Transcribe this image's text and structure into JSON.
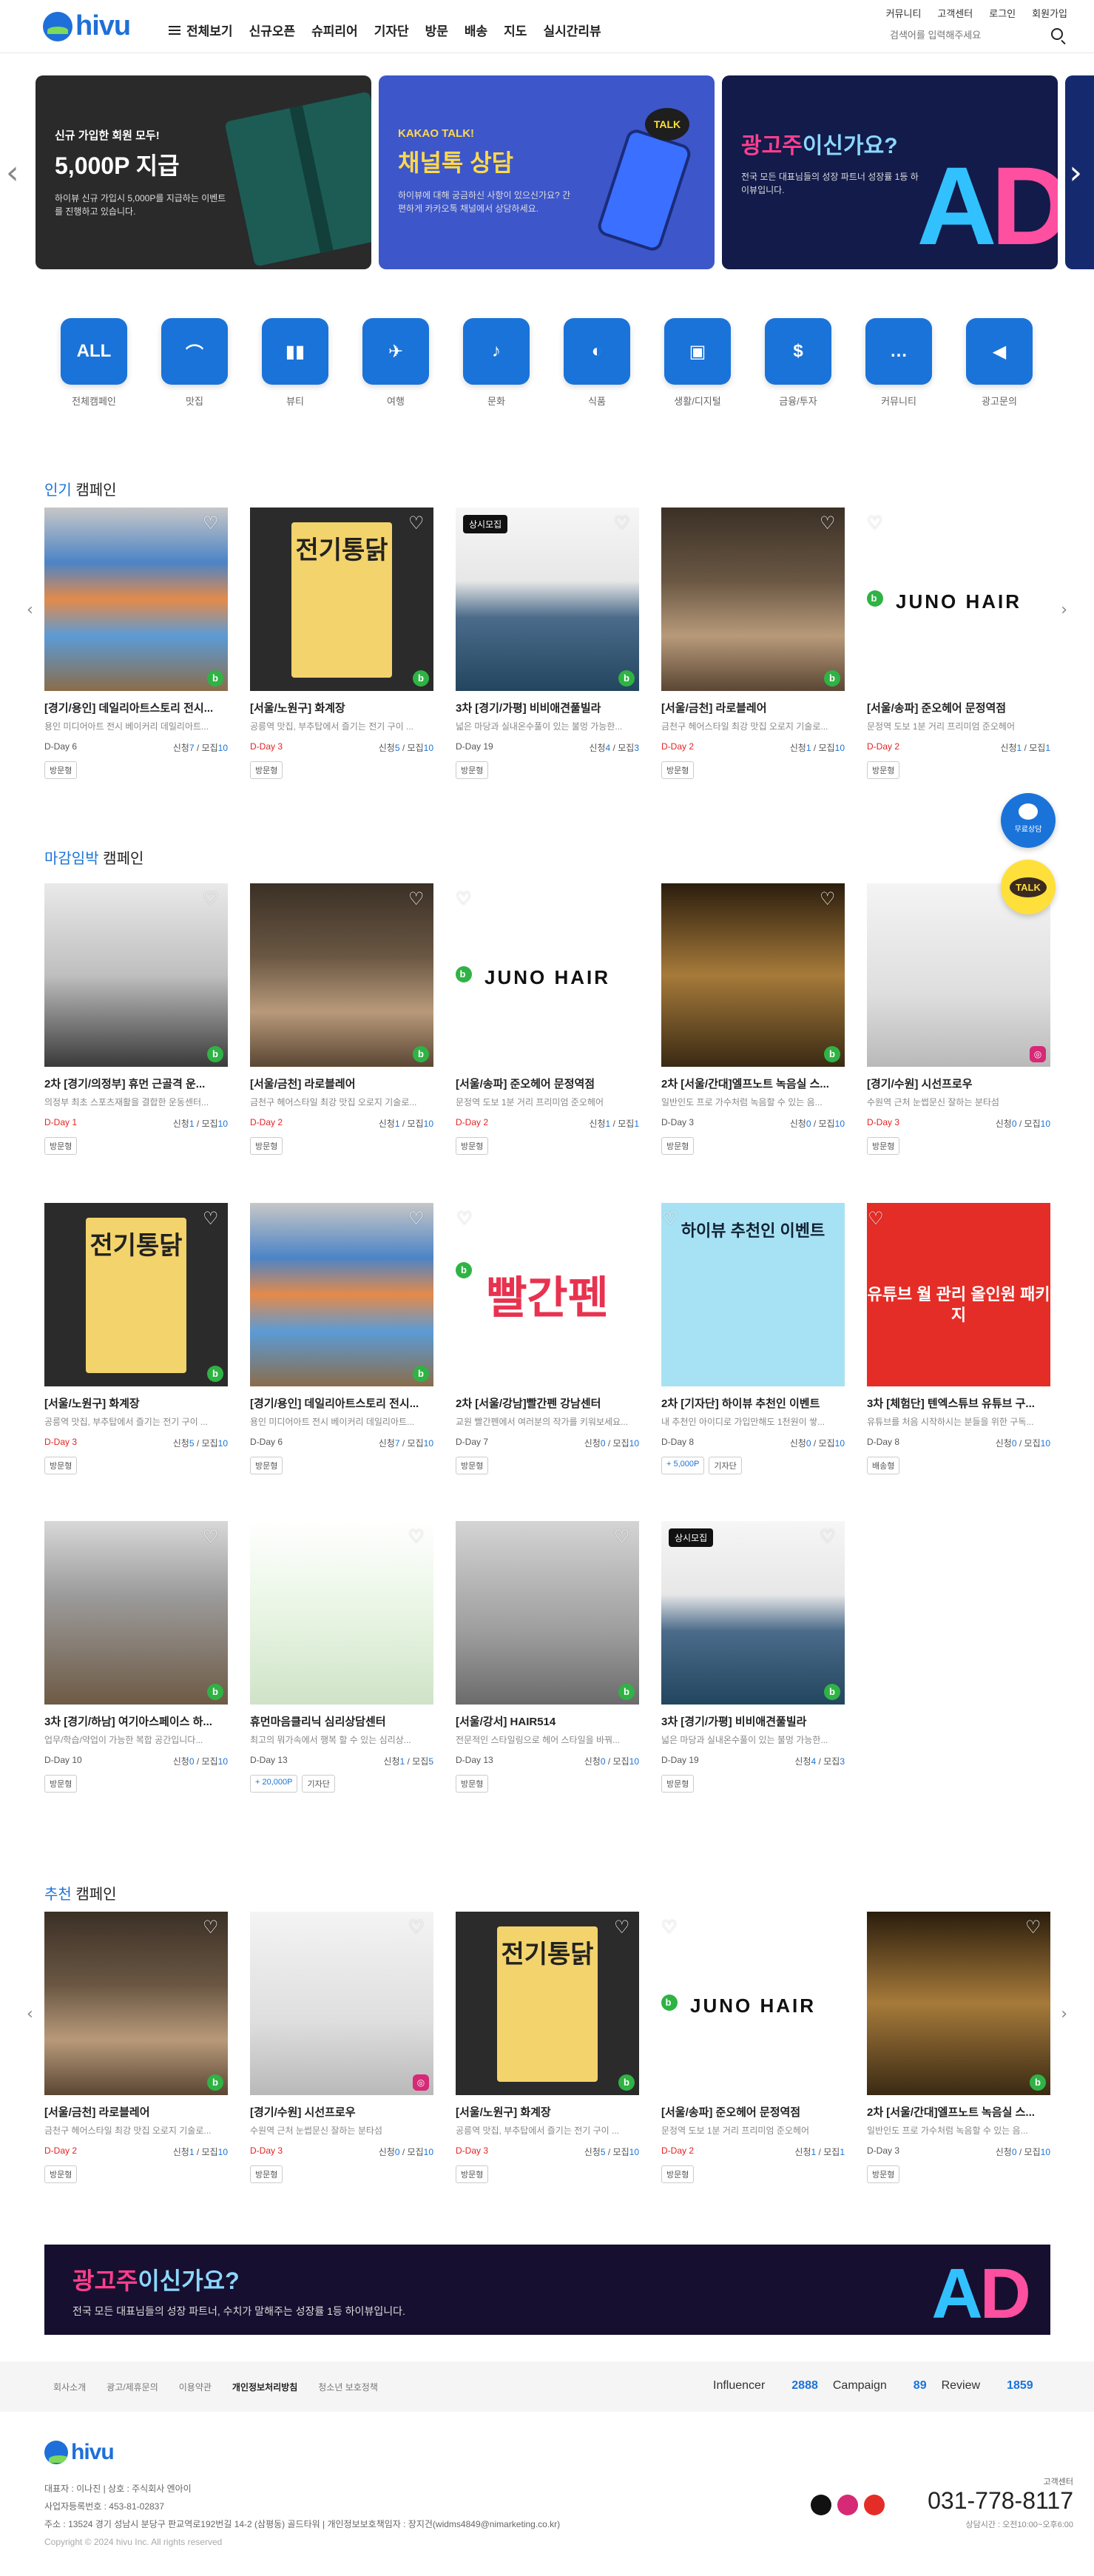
{
  "header": {
    "logo": "hivu",
    "nav": [
      "전체보기",
      "신규오픈",
      "슈피리어",
      "기자단",
      "방문",
      "배송",
      "지도",
      "실시간리뷰"
    ],
    "util": [
      "커뮤니티",
      "고객센터",
      "로그인",
      "회원가입"
    ],
    "search_placeholder": "검색어를 입력해주세요"
  },
  "banners": [
    {
      "small": "신규 가입한 회원 모두!",
      "big": "5,000P 지급",
      "desc": "하이뷰 신규 가입시 5,000P를 지급하는 이벤트를 진행하고 있습니다."
    },
    {
      "small": "KAKAO TALK!",
      "big": "채널톡 상담",
      "desc": "하이뷰에 대해 궁금하신 사항이 있으신가요? 간편하게 카카오톡 채널에서 상담하세요.",
      "talk": "TALK"
    },
    {
      "big_a": "광고주",
      "big_b": "이신가요?",
      "desc": "전국 모든 대표님들의 성장 파트너 성장률 1등 하이뷰입니다.",
      "ad_a": "A",
      "ad_b": "D"
    }
  ],
  "categories": [
    {
      "label": "전체캠페인",
      "icon_text": "ALL",
      "icon": "all-icon"
    },
    {
      "label": "맛집",
      "icon": "food-icon"
    },
    {
      "label": "뷰티",
      "icon": "beauty-icon"
    },
    {
      "label": "여행",
      "icon": "airplane-icon"
    },
    {
      "label": "문화",
      "icon": "culture-icon"
    },
    {
      "label": "식품",
      "icon": "food-product-icon"
    },
    {
      "label": "생활/디지털",
      "icon": "camera-icon"
    },
    {
      "label": "금융/투자",
      "icon": "coin-icon"
    },
    {
      "label": "커뮤니티",
      "icon": "chat-icon"
    },
    {
      "label": "광고문의",
      "icon": "megaphone-icon"
    }
  ],
  "sections": {
    "popular": {
      "accent": "인기",
      "rest": " 캠페인"
    },
    "closing": {
      "accent": "마감임박",
      "rest": " 캠페인"
    },
    "recommend": {
      "accent": "추천",
      "rest": " 캠페인"
    }
  },
  "labels": {
    "applied": "신청",
    "recruit": "모집",
    "visit": "방문형",
    "delivery": "배송형",
    "reporter": "기자단",
    "recruiting": "상시모집"
  },
  "popular": [
    {
      "art": "t-art",
      "title": "[경기/용인] 데일리아트스토리 전시...",
      "desc": "용인 미디어아트 전시 베이커리 데일리아트...",
      "dday": "D-Day 6",
      "red": false,
      "applied": "7",
      "recruit": "10",
      "badges": [
        "방문형"
      ],
      "icon": "blog"
    },
    {
      "art": "t-chicken",
      "title": "[서울/노원구] 화계장",
      "desc": "공릉역 맛집, 부추탑에서 즐기는 전기 구이 ...",
      "dday": "D-Day 3",
      "red": true,
      "applied": "5",
      "recruit": "10",
      "badges": [
        "방문형"
      ],
      "icon": "blog"
    },
    {
      "art": "t-pool",
      "title": "3차 [경기/가평] 비비애견풀빌라",
      "desc": "넓은 마당과 실내온수풀이 있는 불멍 가능한...",
      "dday": "D-Day 19",
      "red": false,
      "applied": "4",
      "recruit": "3",
      "badges": [
        "방문형"
      ],
      "icon": "blog",
      "tag": "상시모집"
    },
    {
      "art": "t-salon",
      "title": "[서울/금천] 라로블레어",
      "desc": "금천구 헤어스타일 최강 맛집 오로지 기술로...",
      "dday": "D-Day 2",
      "red": true,
      "applied": "1",
      "recruit": "10",
      "badges": [
        "방문형"
      ],
      "icon": "blog"
    },
    {
      "art": "t-juno",
      "title": "[서울/송파] 준오헤어 문정역점",
      "desc": "문정역 도보 1분 거리 프리미엄 준오헤어",
      "dday": "D-Day 2",
      "red": true,
      "applied": "1",
      "recruit": "1",
      "badges": [
        "방문형"
      ],
      "icon": "blog",
      "juno": "JUNO HAIR"
    }
  ],
  "closing": [
    {
      "art": "t-gym",
      "title": "2차 [경기/의정부] 휴먼 근골격 운...",
      "desc": "의정부 최초 스포츠재활을 결합한 운동센터...",
      "dday": "D-Day 1",
      "red": true,
      "applied": "1",
      "recruit": "10",
      "badges": [
        "방문형"
      ],
      "icon": "blog"
    },
    {
      "art": "t-salon",
      "title": "[서울/금천] 라로블레어",
      "desc": "금천구 헤어스타일 최강 맛집 오로지 기술로...",
      "dday": "D-Day 2",
      "red": true,
      "applied": "1",
      "recruit": "10",
      "badges": [
        "방문형"
      ],
      "icon": "blog"
    },
    {
      "art": "t-juno",
      "title": "[서울/송파] 준오헤어 문정역점",
      "desc": "문정역 도보 1분 거리 프리미엄 준오헤어",
      "dday": "D-Day 2",
      "red": true,
      "applied": "1",
      "recruit": "1",
      "badges": [
        "방문형"
      ],
      "icon": "blog",
      "juno": "JUNO HAIR"
    },
    {
      "art": "t-mic",
      "title": "2차 [서울/간대]엘프노트 녹음실 스...",
      "desc": "일반인도 프로 가수처럼 녹음할 수 있는 음...",
      "dday": "D-Day 3",
      "red": false,
      "applied": "0",
      "recruit": "10",
      "badges": [
        "방문형"
      ],
      "icon": "blog"
    },
    {
      "art": "t-white",
      "title": "[경기/수원] 시선프로우",
      "desc": "수원역 근처 눈썹문신 잘하는 분타섬",
      "dday": "D-Day 3",
      "red": true,
      "applied": "0",
      "recruit": "10",
      "badges": [
        "방문형"
      ],
      "icon": "insta"
    },
    {
      "art": "t-chicken",
      "title": "[서울/노원구] 화계장",
      "desc": "공릉역 맛집, 부추탑에서 즐기는 전기 구이 ...",
      "dday": "D-Day 3",
      "red": true,
      "applied": "5",
      "recruit": "10",
      "badges": [
        "방문형"
      ],
      "icon": "blog"
    },
    {
      "art": "t-art",
      "title": "[경기/용인] 데일리아트스토리 전시...",
      "desc": "용인 미디어아트 전시 베이커리 데일리아트...",
      "dday": "D-Day 6",
      "red": false,
      "applied": "7",
      "recruit": "10",
      "badges": [
        "방문형"
      ],
      "icon": "blog"
    },
    {
      "art": "t-ppalgan",
      "title": "2차 [서울/강남]빨간펜 강남센터",
      "desc": "교원 빨간펜에서 여러분의 작가를 키워보세요...",
      "dday": "D-Day 7",
      "red": false,
      "applied": "0",
      "recruit": "10",
      "badges": [
        "방문형"
      ],
      "icon": "blog",
      "big": "빨간펜"
    },
    {
      "art": "t-event",
      "title": "2차 [기자단] 하이뷰 추천인 이벤트",
      "desc": "내 추천인 아이디로 가입만해도 1천원이 쌓...",
      "dday": "D-Day 8",
      "red": false,
      "applied": "0",
      "recruit": "10",
      "badges": [
        "+ 5,000P",
        "기자단"
      ],
      "icon": "none",
      "event": "하이뷰 추천인 이벤트"
    },
    {
      "art": "t-youtube",
      "title": "3차 [체험단] 텐엑스튜브 유튜브 구...",
      "desc": "유튜브를 처음 시작하시는 분들을 위한 구독...",
      "dday": "D-Day 8",
      "red": false,
      "applied": "0",
      "recruit": "10",
      "badges": [
        "배송형"
      ],
      "icon": "none",
      "yt": "유튜브 월 관리 올인원 패키지"
    },
    {
      "art": "t-cafe",
      "title": "3차 [경기/하남] 여기아스페이스 하...",
      "desc": "업무/학습/약업이 가능한 복합 공간입니다...",
      "dday": "D-Day 10",
      "red": false,
      "applied": "0",
      "recruit": "10",
      "badges": [
        "방문형"
      ],
      "icon": "blog"
    },
    {
      "art": "t-clinic",
      "title": "휴먼마음클리닉 심리상담센터",
      "desc": "최고의 뭐가속에서 행복 할 수 있는 심리상...",
      "dday": "D-Day 13",
      "red": false,
      "applied": "1",
      "recruit": "5",
      "badges": [
        "+ 20,000P",
        "기자단"
      ],
      "icon": "none"
    },
    {
      "art": "t-hair514",
      "title": "[서울/강서] HAIR514",
      "desc": "전문적인 스타일링으로 헤어 스타일을 바꿔...",
      "dday": "D-Day 13",
      "red": false,
      "applied": "0",
      "recruit": "10",
      "badges": [
        "방문형"
      ],
      "icon": "blog"
    },
    {
      "art": "t-pool",
      "title": "3차 [경기/가평] 비비애견풀빌라",
      "desc": "넓은 마당과 실내온수풀이 있는 불멍 가능한...",
      "dday": "D-Day 19",
      "red": false,
      "applied": "4",
      "recruit": "3",
      "badges": [
        "방문형"
      ],
      "icon": "blog",
      "tag": "상시모집"
    }
  ],
  "recommend": [
    {
      "art": "t-salon",
      "title": "[서울/금천] 라로블레어",
      "desc": "금천구 헤어스타일 최강 맛집 오로지 기술로...",
      "dday": "D-Day 2",
      "red": true,
      "applied": "1",
      "recruit": "10",
      "badges": [
        "방문형"
      ],
      "icon": "blog"
    },
    {
      "art": "t-white",
      "title": "[경기/수원] 시선프로우",
      "desc": "수원역 근처 눈썹문신 잘하는 분타섬",
      "dday": "D-Day 3",
      "red": true,
      "applied": "0",
      "recruit": "10",
      "badges": [
        "방문형"
      ],
      "icon": "insta"
    },
    {
      "art": "t-chicken",
      "title": "[서울/노원구] 화계장",
      "desc": "공릉역 맛집, 부추탑에서 즐기는 전기 구이 ...",
      "dday": "D-Day 3",
      "red": true,
      "applied": "5",
      "recruit": "10",
      "badges": [
        "방문형"
      ],
      "icon": "blog"
    },
    {
      "art": "t-juno",
      "title": "[서울/송파] 준오헤어 문정역점",
      "desc": "문정역 도보 1분 거리 프리미엄 준오헤어",
      "dday": "D-Day 2",
      "red": true,
      "applied": "1",
      "recruit": "1",
      "badges": [
        "방문형"
      ],
      "icon": "blog",
      "juno": "JUNO HAIR"
    },
    {
      "art": "t-mic",
      "title": "2차 [서울/간대]엘프노트 녹음실 스...",
      "desc": "일반인도 프로 가수처럼 녹음할 수 있는 음...",
      "dday": "D-Day 3",
      "red": false,
      "applied": "0",
      "recruit": "10",
      "badges": [
        "방문형"
      ],
      "icon": "blog"
    }
  ],
  "float": {
    "consult": "무료상담",
    "talk": "TALK"
  },
  "adstrip": {
    "big_a": "광고주",
    "big_b": "이신가요?",
    "small": "전국 모든 대표님들의 성장 파트너, 수치가 말해주는 성장률 1등 하이뷰입니다.",
    "ad_a": "A",
    "ad_b": "D"
  },
  "footer": {
    "links": [
      "회사소개",
      "광고/제휴문의",
      "이용약관",
      "개인정보처리방침",
      "청소년 보호정책"
    ],
    "stats": [
      {
        "label": "Influencer",
        "value": "2888"
      },
      {
        "label": "Campaign",
        "value": "89"
      },
      {
        "label": "Review",
        "value": "1859"
      }
    ],
    "logo": "hivu",
    "line1": "대표자 : 이나진   |   상호 : 주식회사 엔아이",
    "line2": "사업자등록번호 : 453-81-02837",
    "line3": "주소 : 13524 경기 성남시 분당구 판교역로192번길 14-2 (삼평동) 골드타워   |   개인정보보호책임자 : 장지건(widms4849@nimarketing.co.kr)",
    "copyright": "Copyright © 2024 hivu Inc. All rights reserved",
    "phone_label": "고객센터",
    "phone": "031-778-8117",
    "hours": "상담시간 : 오전10:00~오후6:00"
  }
}
